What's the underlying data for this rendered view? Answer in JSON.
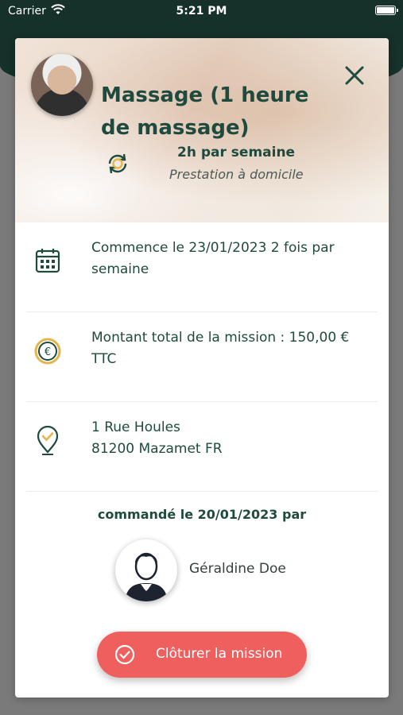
{
  "status_bar": {
    "carrier": "Carrier",
    "time": "5:21 PM"
  },
  "mission": {
    "title": "Massage (1 heure de massage)",
    "frequency": "2h par semaine",
    "location_type": "Prestation à domicile"
  },
  "details": [
    {
      "icon": "calendar-icon",
      "text": "Commence le 23/01/2023 2 fois par semaine"
    },
    {
      "icon": "euro-icon",
      "text": "Montant total de la mission : 150,00 € TTC"
    },
    {
      "icon": "location-pin-icon",
      "address_line1": "1 Rue Houles",
      "address_line2": "81200 Mazamet FR"
    }
  ],
  "ordered": {
    "label": "commandé le 20/01/2023 par",
    "person_name": "Géraldine Doe"
  },
  "actions": {
    "close_mission_label": "Clôturer la mission"
  },
  "colors": {
    "primary": "#1f4a3e",
    "accent": "#ef5f5d",
    "header_bg": "#16302a",
    "gold": "#e2b64a"
  }
}
